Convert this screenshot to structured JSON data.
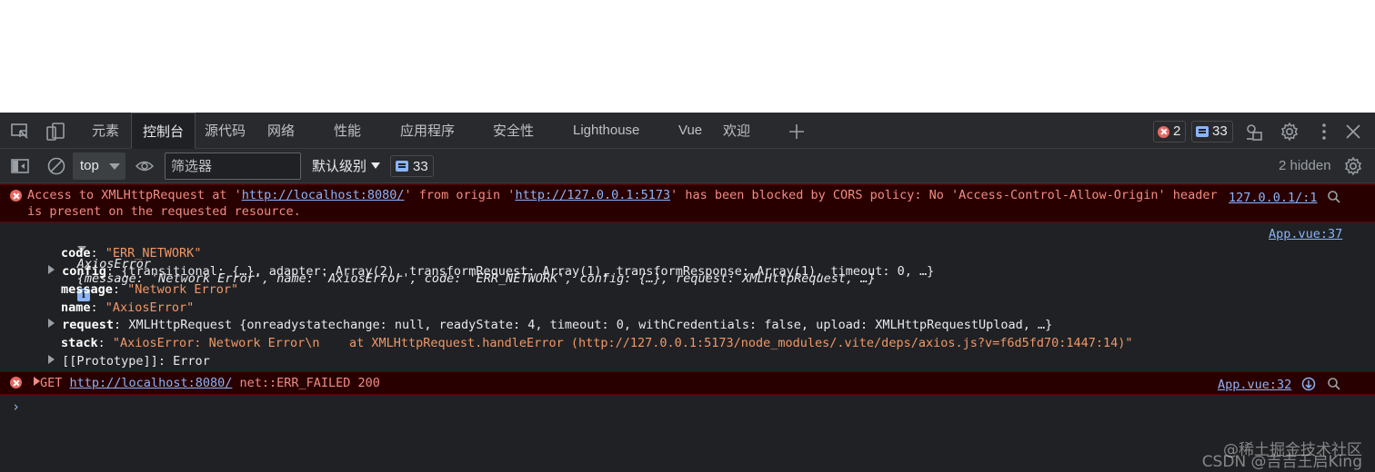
{
  "tabs": [
    "元素",
    "控制台",
    "源代码",
    "网络",
    "性能",
    "应用程序",
    "安全性",
    "Lighthouse",
    "Vue",
    "欢迎"
  ],
  "active_tab": "控制台",
  "badges": {
    "errors": "2",
    "messages": "33"
  },
  "toolbar": {
    "context": "top",
    "filter_placeholder": "筛选器",
    "levels": "默认级别",
    "message_count": "33",
    "hidden": "2 hidden"
  },
  "console": {
    "cors_error": {
      "pre": "Access to XMLHttpRequest at '",
      "url1": "http://localhost:8080/",
      "mid1": "' from origin '",
      "url2": "http://127.0.0.1:5173",
      "mid2": "' has been blocked by CORS policy: No 'Access-Control-Allow-Origin' header",
      "line2": "is present on the requested resource.",
      "source": "127.0.0.1/:1"
    },
    "axios": {
      "summary_name": "AxiosError",
      "summary_body": "{message: 'Network Error', name: 'AxiosError', code: 'ERR_NETWORK', config: {…}, request: XMLHttpRequest, …}",
      "source": "App.vue:37",
      "code_key": "code",
      "code_val": "\"ERR_NETWORK\"",
      "config_key": "config",
      "config_val": "{transitional: {…}, adapter: Array(2), transformRequest: Array(1), transformResponse: Array(1), timeout: 0, …}",
      "message_key": "message",
      "message_val": "\"Network Error\"",
      "name_key": "name",
      "name_val": "\"AxiosError\"",
      "request_key": "request",
      "request_val": "XMLHttpRequest {onreadystatechange: null, readyState: 4, timeout: 0, withCredentials: false, upload: XMLHttpRequestUpload, …}",
      "stack_key": "stack",
      "stack_val": "\"AxiosError: Network Error\\n    at XMLHttpRequest.handleError (http://127.0.0.1:5173/node_modules/.vite/deps/axios.js?v=f6d5fd70:1447:14)\"",
      "proto_key": "[[Prototype]]",
      "proto_val": "Error"
    },
    "get_error": {
      "method": "GET",
      "url": "http://localhost:8080/",
      "rest": "net::ERR_FAILED 200",
      "source": "App.vue:32"
    }
  },
  "watermark": [
    "@稀土掘金技术社区",
    "CSDN @吉吉王启King"
  ]
}
